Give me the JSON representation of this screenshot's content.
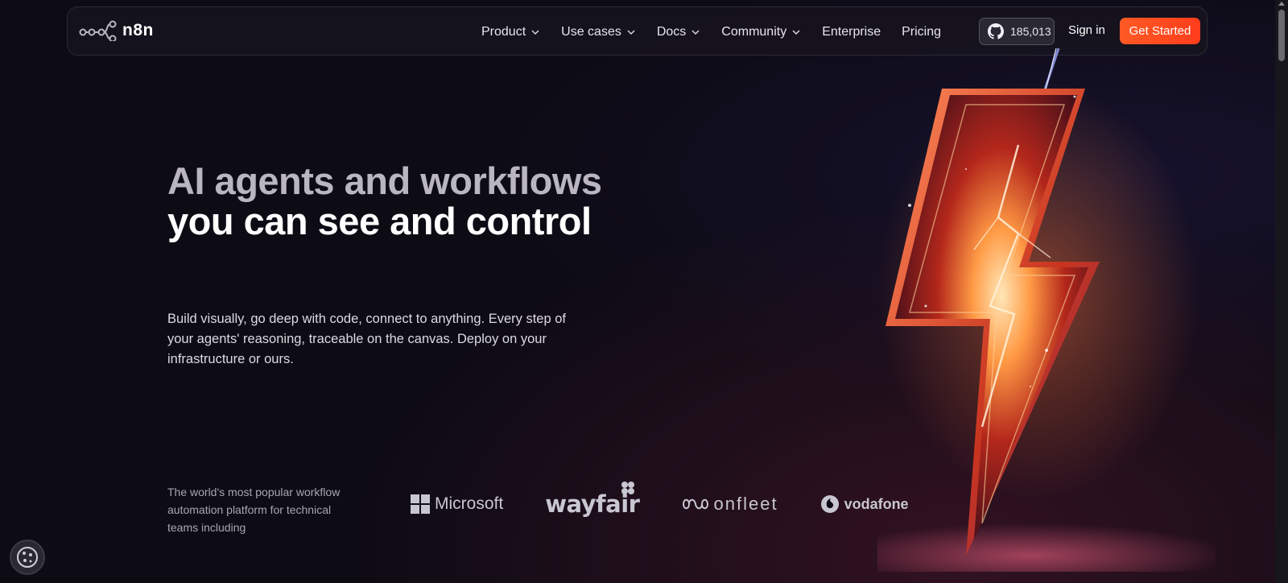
{
  "nav": {
    "logo_text": "n8n",
    "menu": [
      {
        "label": "Product",
        "has_dropdown": true
      },
      {
        "label": "Use cases",
        "has_dropdown": true
      },
      {
        "label": "Docs",
        "has_dropdown": true
      },
      {
        "label": "Community",
        "has_dropdown": true
      },
      {
        "label": "Enterprise",
        "has_dropdown": false
      },
      {
        "label": "Pricing",
        "has_dropdown": false
      }
    ],
    "github_stars": "185,013",
    "sign_in": "Sign in",
    "get_started": "Get Started"
  },
  "hero": {
    "title_line1": "AI agents and workflows",
    "title_line2": "you can see and control",
    "subtitle": "Build visually, go deep with code, connect to anything. Every step of your agents' reasoning, traceable on the canvas. Deploy on your infrastructure or ours.",
    "tagline": "The world's most popular workflow automation platform for technical teams including"
  },
  "brands": [
    {
      "name": "Microsoft",
      "icon": "microsoft-logo-icon"
    },
    {
      "name": "wayfair",
      "icon": "wayfair-logo-icon"
    },
    {
      "name": "onfleet",
      "icon": "onfleet-logo-icon"
    },
    {
      "name": "vodafone",
      "icon": "vodafone-logo-icon"
    }
  ],
  "colors": {
    "background": "#0d0b14",
    "accent": "#ff4f22",
    "bolt_core": "#ffd29a",
    "bolt_edge": "#c2361e"
  }
}
